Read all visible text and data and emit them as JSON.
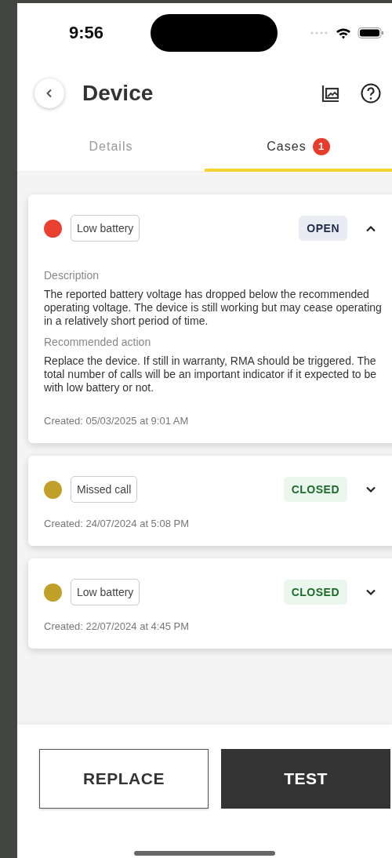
{
  "status_bar": {
    "time": "9:56"
  },
  "header": {
    "title": "Device"
  },
  "tabs": [
    {
      "label": "Details",
      "selected": false
    },
    {
      "label": "Cases",
      "selected": true,
      "badge": "1"
    }
  ],
  "cases": [
    {
      "color": "#ea4030",
      "type": "Low battery",
      "status": "OPEN",
      "kind": "open",
      "expanded": true,
      "description_label": "Description",
      "description": "The reported battery voltage has dropped below the recommended operating voltage. The device is still working but may cease operating in a relatively short period of time.",
      "action_label": "Recommended action",
      "action": "Replace the device. If still in warranty, RMA should be triggered. The total number of calls will be an important indicator if it expected to be with low battery or not.",
      "created": "Created: 05/03/2025 at 9:01 AM"
    },
    {
      "color": "#c1a02a",
      "type": "Missed call",
      "status": "CLOSED",
      "kind": "closed",
      "expanded": false,
      "created": "Created: 24/07/2024 at 5:08 PM"
    },
    {
      "color": "#c1a02a",
      "type": "Low battery",
      "status": "CLOSED",
      "kind": "closed",
      "expanded": false,
      "created": "Created: 22/07/2024 at 4:45 PM"
    }
  ],
  "buttons": [
    {
      "label": "REPLACE",
      "kind": "outline"
    },
    {
      "label": "TEST",
      "kind": "filled"
    }
  ]
}
